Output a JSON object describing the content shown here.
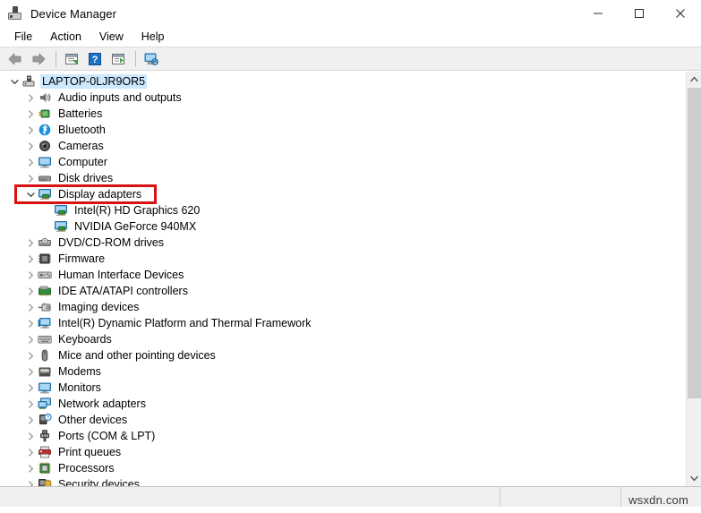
{
  "window": {
    "title": "Device Manager",
    "icon": "device-manager-icon",
    "controls": {
      "minimize": "minimize-icon",
      "maximize": "maximize-icon",
      "close": "close-icon"
    }
  },
  "menubar": {
    "items": [
      {
        "label": "File"
      },
      {
        "label": "Action"
      },
      {
        "label": "View"
      },
      {
        "label": "Help"
      }
    ]
  },
  "toolbar": {
    "buttons": [
      {
        "name": "back-icon",
        "tip": "Back"
      },
      {
        "name": "forward-icon",
        "tip": "Forward"
      },
      {
        "sep": true
      },
      {
        "name": "properties-icon",
        "tip": "Properties"
      },
      {
        "sep": false,
        "name": "help-icon",
        "tip": "Help"
      },
      {
        "name": "show-hidden-devices-icon",
        "tip": "Show hidden devices"
      },
      {
        "sep": true
      },
      {
        "name": "scan-hardware-changes-icon",
        "tip": "Scan for hardware changes"
      }
    ]
  },
  "tree": {
    "root": {
      "label": "LAPTOP-0LJR9OR5",
      "icon": "computer-root-icon",
      "expanded": true,
      "selected": true
    },
    "nodes": [
      {
        "label": "Audio inputs and outputs",
        "icon": "speaker-icon",
        "expanded": false,
        "depth": 1
      },
      {
        "label": "Batteries",
        "icon": "battery-icon",
        "expanded": false,
        "depth": 1
      },
      {
        "label": "Bluetooth",
        "icon": "bluetooth-icon",
        "expanded": false,
        "depth": 1
      },
      {
        "label": "Cameras",
        "icon": "camera-icon",
        "expanded": false,
        "depth": 1
      },
      {
        "label": "Computer",
        "icon": "monitor-icon",
        "expanded": false,
        "depth": 1
      },
      {
        "label": "Disk drives",
        "icon": "disk-drive-icon",
        "expanded": false,
        "depth": 1
      },
      {
        "label": "Display adapters",
        "icon": "display-adapter-icon",
        "expanded": true,
        "depth": 1,
        "highlighted": true
      },
      {
        "label": "Intel(R) HD Graphics 620",
        "icon": "display-adapter-icon",
        "leaf": true,
        "depth": 2
      },
      {
        "label": "NVIDIA GeForce 940MX",
        "icon": "display-adapter-icon",
        "leaf": true,
        "depth": 2
      },
      {
        "label": "DVD/CD-ROM drives",
        "icon": "dvd-drive-icon",
        "expanded": false,
        "depth": 1
      },
      {
        "label": "Firmware",
        "icon": "firmware-icon",
        "expanded": false,
        "depth": 1
      },
      {
        "label": "Human Interface Devices",
        "icon": "hid-icon",
        "expanded": false,
        "depth": 1
      },
      {
        "label": "IDE ATA/ATAPI controllers",
        "icon": "ide-controller-icon",
        "expanded": false,
        "depth": 1
      },
      {
        "label": "Imaging devices",
        "icon": "imaging-device-icon",
        "expanded": false,
        "depth": 1
      },
      {
        "label": "Intel(R) Dynamic Platform and Thermal Framework",
        "icon": "thermal-framework-icon",
        "expanded": false,
        "depth": 1
      },
      {
        "label": "Keyboards",
        "icon": "keyboard-icon",
        "expanded": false,
        "depth": 1
      },
      {
        "label": "Mice and other pointing devices",
        "icon": "mouse-icon",
        "expanded": false,
        "depth": 1
      },
      {
        "label": "Modems",
        "icon": "modem-icon",
        "expanded": false,
        "depth": 1
      },
      {
        "label": "Monitors",
        "icon": "monitor-icon",
        "expanded": false,
        "depth": 1
      },
      {
        "label": "Network adapters",
        "icon": "network-adapter-icon",
        "expanded": false,
        "depth": 1
      },
      {
        "label": "Other devices",
        "icon": "other-device-icon",
        "expanded": false,
        "depth": 1
      },
      {
        "label": "Ports (COM & LPT)",
        "icon": "port-icon",
        "expanded": false,
        "depth": 1
      },
      {
        "label": "Print queues",
        "icon": "printer-icon",
        "expanded": false,
        "depth": 1
      },
      {
        "label": "Processors",
        "icon": "processor-icon",
        "expanded": false,
        "depth": 1
      },
      {
        "label": "Security devices",
        "icon": "security-device-icon",
        "expanded": false,
        "depth": 1
      }
    ]
  },
  "annotation": {
    "color": "#d81111",
    "target": "Display adapters"
  },
  "scrollbar": {
    "up": "scroll-up-arrow",
    "down": "scroll-down-arrow"
  },
  "statusbar": {
    "pane1": "",
    "pane2": "",
    "watermark": "wsxdn.com"
  }
}
